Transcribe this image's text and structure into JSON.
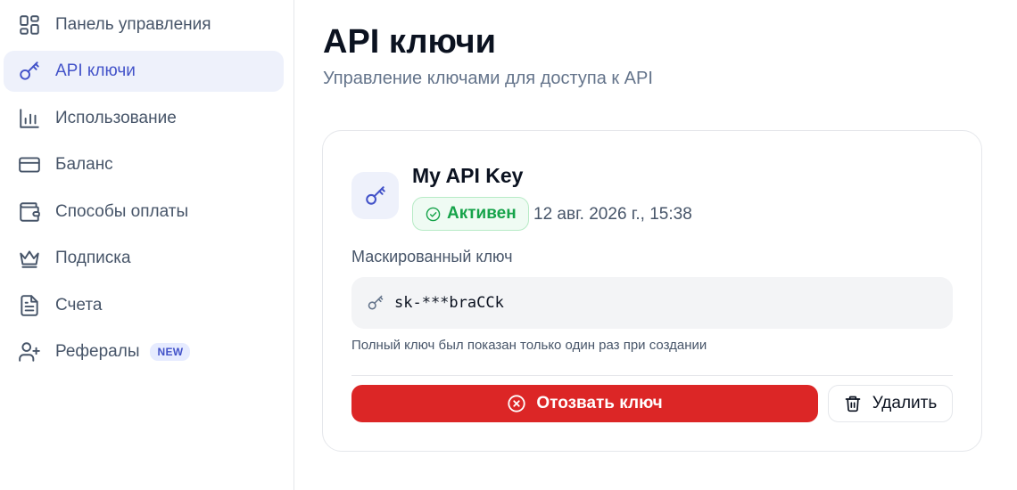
{
  "sidebar": {
    "items": [
      {
        "label": "Панель управления",
        "icon": "dashboard-icon",
        "active": false
      },
      {
        "label": "API ключи",
        "icon": "key-icon",
        "active": true
      },
      {
        "label": "Использование",
        "icon": "bar-chart-icon",
        "active": false
      },
      {
        "label": "Баланс",
        "icon": "credit-card-icon",
        "active": false
      },
      {
        "label": "Способы оплаты",
        "icon": "wallet-icon",
        "active": false
      },
      {
        "label": "Подписка",
        "icon": "crown-icon",
        "active": false
      },
      {
        "label": "Счета",
        "icon": "file-text-icon",
        "active": false
      },
      {
        "label": "Рефералы",
        "icon": "user-plus-icon",
        "active": false,
        "badge": "NEW"
      }
    ]
  },
  "main": {
    "title": "API ключи",
    "subtitle": "Управление ключами для доступа к API"
  },
  "key_card": {
    "name": "My API Key",
    "status": "Активен",
    "created_at": "12 авг. 2026 г., 15:38",
    "masked_label": "Маскированный ключ",
    "masked_value": "sk-***braCCk",
    "hint": "Полный ключ был показан только один раз при создании",
    "revoke_label": "Отозвать ключ",
    "delete_label": "Удалить"
  },
  "colors": {
    "accent": "#4353c9",
    "danger": "#dc2626",
    "success": "#16a34a",
    "active_nav_bg": "#eef1fb"
  }
}
